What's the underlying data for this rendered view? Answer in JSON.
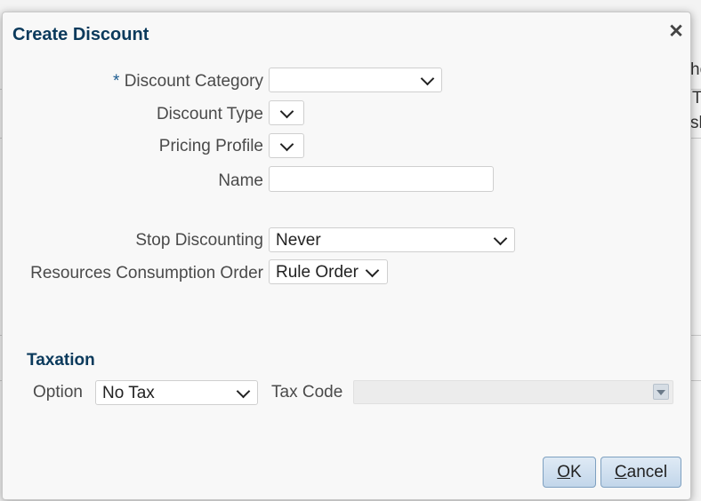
{
  "background": {
    "fragments": [
      "ho",
      "T",
      "sh"
    ]
  },
  "dialog": {
    "title": "Create Discount",
    "close_glyph": "✕",
    "fields": {
      "discount_category": {
        "required_mark": "*",
        "label": "Discount Category",
        "value": ""
      },
      "discount_type": {
        "label": "Discount Type",
        "value": ""
      },
      "pricing_profile": {
        "label": "Pricing Profile",
        "value": ""
      },
      "name": {
        "label": "Name",
        "value": ""
      },
      "stop_discounting": {
        "label": "Stop Discounting",
        "value": "Never"
      },
      "resources_consumption_order": {
        "label": "Resources Consumption Order",
        "value": "Rule Order"
      }
    },
    "taxation": {
      "heading": "Taxation",
      "option": {
        "label": "Option",
        "value": "No Tax"
      },
      "tax_code": {
        "label": "Tax Code",
        "value": ""
      }
    },
    "buttons": {
      "ok": {
        "label_underlined": "O",
        "label_rest": "K"
      },
      "cancel": {
        "label_underlined": "C",
        "label_rest": "ancel"
      }
    }
  }
}
